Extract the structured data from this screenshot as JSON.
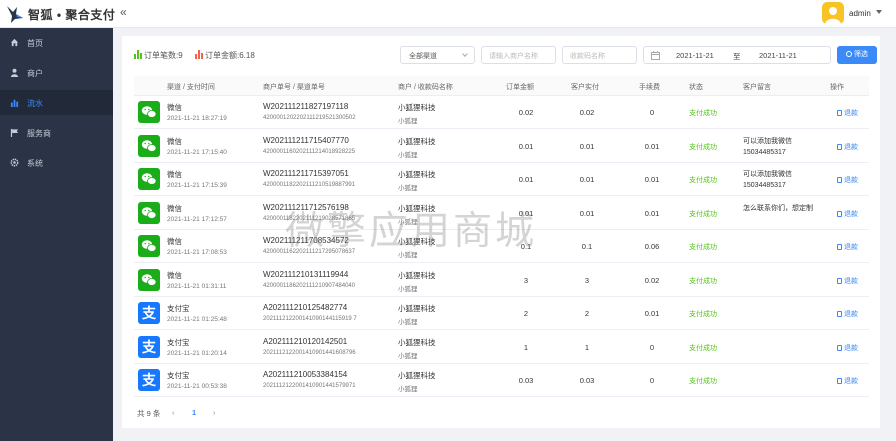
{
  "brand": {
    "title": "智狐 • 聚合支付"
  },
  "user": {
    "name": "admin"
  },
  "sidebar": {
    "items": [
      {
        "label": "首页",
        "icon": "home-icon"
      },
      {
        "label": "商户",
        "icon": "user-icon"
      },
      {
        "label": "流水",
        "icon": "bar-chart-icon"
      },
      {
        "label": "服务商",
        "icon": "flag-icon"
      },
      {
        "label": "系统",
        "icon": "gear-icon"
      }
    ]
  },
  "stats": {
    "order_count": "订单笔数:9",
    "order_amount": "订单金额:6.18"
  },
  "filters": {
    "channel_value": "全部渠道",
    "merchant_placeholder": "请输入商户名称",
    "code_placeholder": "收款码名称",
    "date_start": "2021-11-21",
    "date_sep": "至",
    "date_end": "2021-11-21",
    "search_label": "筛选"
  },
  "colors": {
    "accent": "#3b8af7",
    "wechat": "#1aad19",
    "alipay": "#1677ff",
    "success": "#52c41a",
    "sidebar": "#2b3447"
  },
  "table": {
    "headers": [
      "渠道 / 支付时间",
      "商户单号 / 渠道单号",
      "商户 / 收款码名称",
      "订单金额",
      "客户实付",
      "手续费",
      "状态",
      "客户留言",
      "操作"
    ],
    "rows": [
      {
        "channel": "微信",
        "icon": "wechat-icon",
        "time": "2021-11-21 18:27:19",
        "order_no": "W202111211827197118",
        "channel_no": "4200001202202111219521300502",
        "merchant": "小狐狸科技",
        "code": "小狐狸",
        "amount": "0.02",
        "paid": "0.02",
        "fee": "0",
        "status": "支付成功",
        "message": "",
        "action": "退款"
      },
      {
        "channel": "微信",
        "icon": "wechat-icon",
        "time": "2021-11-21 17:15:40",
        "order_no": "W202111211715407770",
        "channel_no": "4200001160202111214018928225",
        "merchant": "小狐狸科技",
        "code": "小狐狸",
        "amount": "0.01",
        "paid": "0.01",
        "fee": "0.01",
        "status": "支付成功",
        "message": "可以添加我微信15034485317",
        "action": "退款"
      },
      {
        "channel": "微信",
        "icon": "wechat-icon",
        "time": "2021-11-21 17:15:39",
        "order_no": "W202111211715397051",
        "channel_no": "4200001182202111210519887991",
        "merchant": "小狐狸科技",
        "code": "小狐狸",
        "amount": "0.01",
        "paid": "0.01",
        "fee": "0.01",
        "status": "支付成功",
        "message": "可以添加我微信15034485317",
        "action": "退款"
      },
      {
        "channel": "微信",
        "icon": "wechat-icon",
        "time": "2021-11-21 17:12:57",
        "order_no": "W202111211712576198",
        "channel_no": "4200001182202111219028571865",
        "merchant": "小狐狸科技",
        "code": "小狐狸",
        "amount": "0.01",
        "paid": "0.01",
        "fee": "0.01",
        "status": "支付成功",
        "message": "怎么联系你们，想定制",
        "action": "退款"
      },
      {
        "channel": "微信",
        "icon": "wechat-icon",
        "time": "2021-11-21 17:08:53",
        "order_no": "W202111211708534572",
        "channel_no": "4200001162202111217295078637",
        "merchant": "小狐狸科技",
        "code": "小狐狸",
        "amount": "0.1",
        "paid": "0.1",
        "fee": "0.06",
        "status": "支付成功",
        "message": "",
        "action": "退款"
      },
      {
        "channel": "微信",
        "icon": "wechat-icon",
        "time": "2021-11-21 01:31:11",
        "order_no": "W202111210131119944",
        "channel_no": "4200001186202111210907484040",
        "merchant": "小狐狸科技",
        "code": "小狐狸",
        "amount": "3",
        "paid": "3",
        "fee": "0.02",
        "status": "支付成功",
        "message": "",
        "action": "退款"
      },
      {
        "channel": "支付宝",
        "icon": "alipay-icon",
        "time": "2021-11-21 01:25:48",
        "order_no": "A202111210125482774",
        "channel_no": "202111212200141090144115919 7",
        "merchant": "小狐狸科技",
        "code": "小狐狸",
        "amount": "2",
        "paid": "2",
        "fee": "0.01",
        "status": "支付成功",
        "message": "",
        "action": "退款"
      },
      {
        "channel": "支付宝",
        "icon": "alipay-icon",
        "time": "2021-11-21 01:20:14",
        "order_no": "A202111210120142501",
        "channel_no": "2021112122001410901441608796",
        "merchant": "小狐狸科技",
        "code": "小狐狸",
        "amount": "1",
        "paid": "1",
        "fee": "0",
        "status": "支付成功",
        "message": "",
        "action": "退款"
      },
      {
        "channel": "支付宝",
        "icon": "alipay-icon",
        "time": "2021-11-21 00:53:38",
        "order_no": "A202111210053384154",
        "channel_no": "2021112122001410901441579971",
        "merchant": "小狐狸科技",
        "code": "小狐狸",
        "amount": "0.03",
        "paid": "0.03",
        "fee": "0",
        "status": "支付成功",
        "message": "",
        "action": "退款"
      }
    ]
  },
  "pagination": {
    "total": "共 9 条",
    "prev": "‹",
    "current": "1",
    "next": "›"
  },
  "watermark": "微擎应用商城"
}
